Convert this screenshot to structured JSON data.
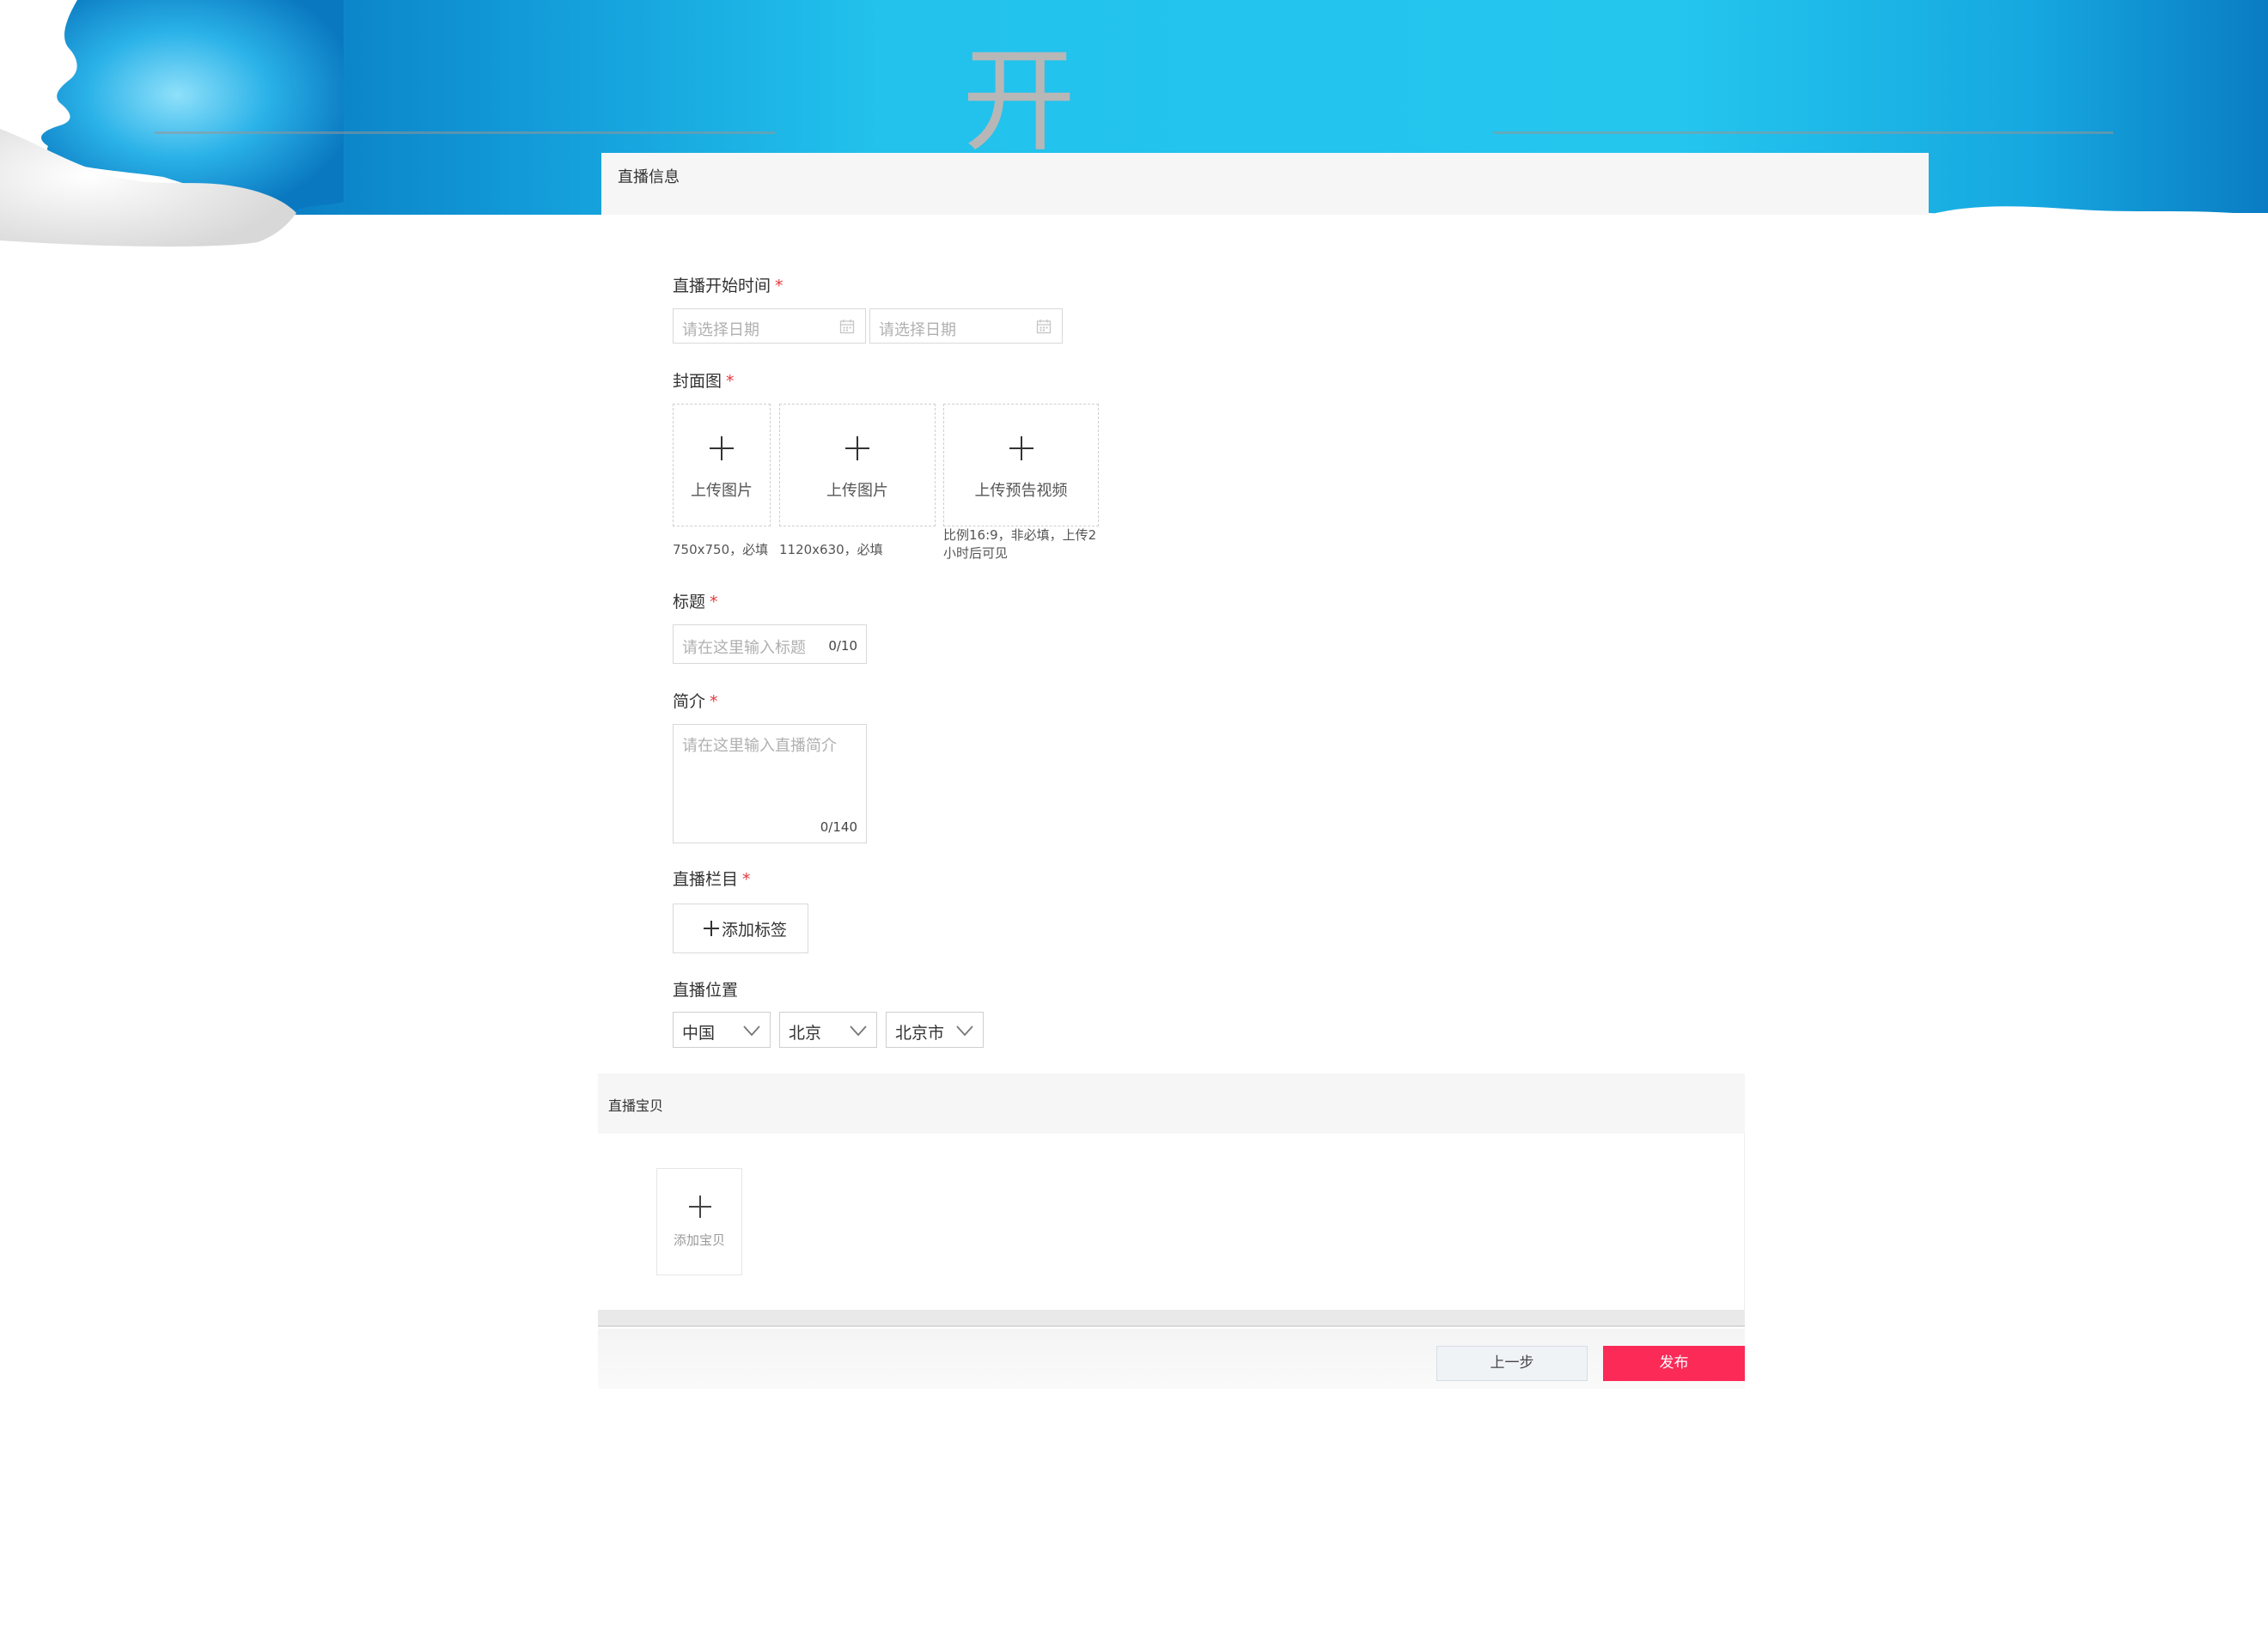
{
  "header": {
    "page_title": "开通"
  },
  "live_info": {
    "section_title": "直播信息",
    "start_time": {
      "label": "直播开始时间",
      "required_mark": "*",
      "start_placeholder": "请选择日期",
      "end_placeholder": "请选择日期",
      "icon": "calendar-icon"
    },
    "cover": {
      "label": "封面图",
      "required_mark": "*",
      "slots": [
        {
          "label": "上传图片",
          "hint": "750x750，必填"
        },
        {
          "label": "上传图片",
          "hint": "1120x630，必填"
        },
        {
          "label": "上传预告视频",
          "hint": "比例16:9，非必填，上传2小时后可见"
        }
      ]
    },
    "title_field": {
      "label": "标题",
      "required_mark": "*",
      "placeholder": "请在这里输入标题",
      "counter": "0/10"
    },
    "intro_field": {
      "label": "简介",
      "required_mark": "*",
      "placeholder": "请在这里输入直播简介",
      "counter": "0/140"
    },
    "category": {
      "label": "直播栏目",
      "required_mark": "*",
      "add_tag_label": "添加标签"
    },
    "location": {
      "label": "直播位置",
      "country": "中国",
      "province": "北京",
      "city": "北京市"
    }
  },
  "products": {
    "section_title": "直播宝贝",
    "add_label": "添加宝贝"
  },
  "footer": {
    "prev_label": "上一步",
    "publish_label": "发布"
  },
  "colors": {
    "banner_blue": "#22c4ec",
    "publish_red": "#fb2a57",
    "required_red": "#e4393c",
    "section_gray": "#f6f6f6"
  }
}
